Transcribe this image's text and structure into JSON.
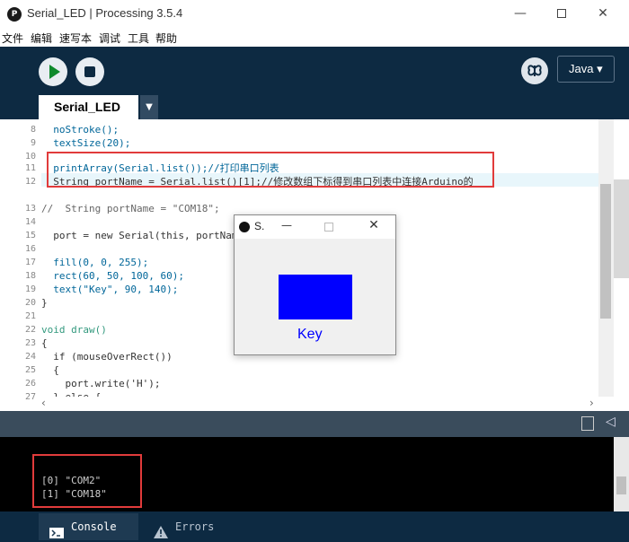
{
  "window": {
    "app_icon": "processing-icon",
    "title": "Serial_LED | Processing 3.5.4",
    "minimize": "—",
    "close": "✕"
  },
  "menu": {
    "items": [
      "文件",
      "编辑",
      "速写本",
      "调试",
      "工具",
      "帮助"
    ]
  },
  "toolbar": {
    "run_icon": "play-icon",
    "stop_icon": "stop-icon",
    "debug_icon": "butterfly-icon",
    "mode": "Java ▾"
  },
  "tab": {
    "name": "Serial_LED",
    "menu_arrow": "▼"
  },
  "editor": {
    "lines": [
      {
        "num": "8",
        "code": "  noStroke();"
      },
      {
        "num": "9",
        "code": "  textSize(20);"
      },
      {
        "num": "10",
        "code": ""
      },
      {
        "num": "11",
        "code": "  printArray(Serial.list());//打印串口列表"
      },
      {
        "num": "12",
        "code": "  String portName = Serial.list()[1];//修改数组下标得到串口列表中连接Arduino的"
      },
      {
        "num": "13",
        "code": "//  String portName = \"COM18\";"
      },
      {
        "num": "14",
        "code": ""
      },
      {
        "num": "15",
        "code": "  port = new Serial(this, portName, 9600);"
      },
      {
        "num": "16",
        "code": ""
      },
      {
        "num": "17",
        "code": "  fill(0, 0, 255);"
      },
      {
        "num": "18",
        "code": "  rect(60, 50, 100, 60);"
      },
      {
        "num": "19",
        "code": "  text(\"Key\", 90, 140);"
      },
      {
        "num": "20",
        "code": "}"
      },
      {
        "num": "21",
        "code": ""
      },
      {
        "num": "22",
        "code": "void draw()"
      },
      {
        "num": "23",
        "code": "{"
      },
      {
        "num": "24",
        "code": "  if (mouseOverRect())"
      },
      {
        "num": "25",
        "code": "  {"
      },
      {
        "num": "26",
        "code": "    port.write('H');"
      },
      {
        "num": "27",
        "code": "  } else {"
      }
    ],
    "scroll_right": "›",
    "scroll_left": "‹"
  },
  "console": {
    "lines": [
      "[0] \"COM2\"",
      "[1] \"COM18\""
    ],
    "copy_icon": "copy-icon",
    "toggle_icon": "triangle-left-icon",
    "toggle_glyph": "◁"
  },
  "bottom_tabs": {
    "console": "Console",
    "errors": "Errors"
  },
  "sketch": {
    "title": "S.",
    "min": "—",
    "close": "✕",
    "label": "Key",
    "fill_color": "#0000ff"
  }
}
